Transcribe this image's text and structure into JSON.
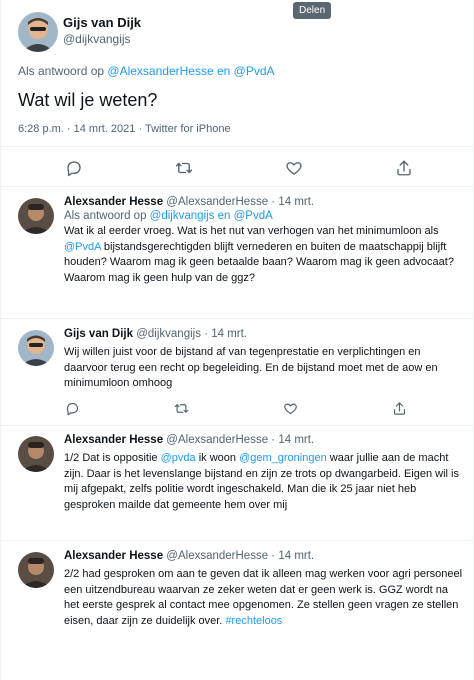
{
  "tooltip": "Delen",
  "main_tweet": {
    "author_name": "Gijs van Dijk",
    "author_handle": "@dijkvangijs",
    "reply_prefix": "Als antwoord op ",
    "reply_to_1": "@AlexsanderHesse",
    "reply_and": " en ",
    "reply_to_2": "@PvdA",
    "text": "Wat wil je weten?",
    "meta": "6:28 p.m. · 14 mrt. 2021 · Twitter for iPhone"
  },
  "action_icons": [
    "reply-icon",
    "retweet-icon",
    "like-icon",
    "share-icon"
  ],
  "replies": [
    {
      "author_name": "Alexsander Hesse",
      "author_handle": "@AlexsanderHesse",
      "sep": " · ",
      "date": "14 mrt.",
      "reply_prefix": "Als antwoord op ",
      "reply_to_1": "@dijkvangijs",
      "reply_and": " en ",
      "reply_to_2": "@PvdA",
      "text_1": "Wat ik al eerder vroeg. Wat is het nut van verhogen van het minimumloon als ",
      "text_link": "@PvdA",
      "text_2": " bijstandsgerechtigden blijft vernederen en buiten de maatschappij blijft houden? Waarom mag ik geen betaalde baan? Waarom mag ik geen advocaat? Waarom mag ik geen hulp van de ggz?"
    },
    {
      "author_name": "Gijs van Dijk",
      "author_handle": "@dijkvangijs",
      "sep": " · ",
      "date": "14 mrt.",
      "text": "Wij willen juist voor de bijstand af van tegenprestatie en verplichtingen en daarvoor terug een recht op begeleiding. En de bijstand moet met de aow en minimumloon omhoog"
    },
    {
      "author_name": "Alexsander Hesse",
      "author_handle": "@AlexsanderHesse",
      "sep": " · ",
      "date": "14 mrt.",
      "text_1": "1/2 Dat is oppositie ",
      "text_link_1": "@pvda",
      "text_2": " ik woon ",
      "text_link_2": "@gem_groningen",
      "text_3": " waar jullie aan de macht zijn. Daar is het levenslange bijstand en zijn ze trots op dwangarbeid. Eigen wil is mij afgepakt, zelfs politie wordt ingeschakeld. Man die ik 25 jaar niet heb gesproken mailde dat gemeente hem over mij"
    },
    {
      "author_name": "Alexsander Hesse",
      "author_handle": "@AlexsanderHesse",
      "sep": " · ",
      "date": "14 mrt.",
      "text_1": "2/2 had gesproken om aan te geven dat ik alleen mag werken voor agri personeel een uitzendbureau waarvan ze zeker weten dat er geen werk is. GGZ wordt na het eerste gesprek al contact mee opgenomen. Ze stellen geen vragen ze stellen eisen, daar zijn ze duidelijk over. ",
      "text_link": "#rechteloos"
    }
  ],
  "colors": {
    "accent": "#1d9bf0",
    "text": "#0f1419",
    "muted": "#536471",
    "divider": "#eff3f4"
  }
}
